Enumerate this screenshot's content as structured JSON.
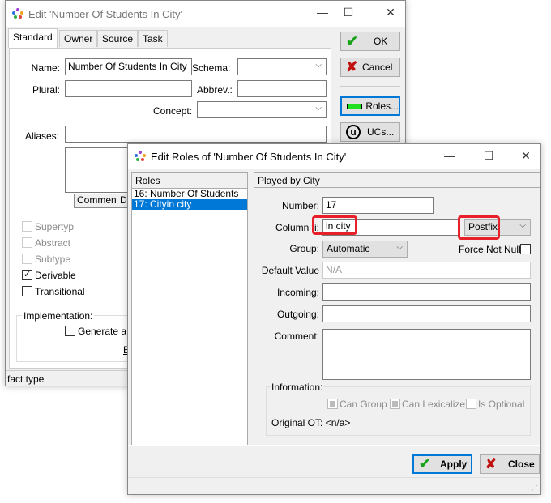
{
  "main_window": {
    "title": "Edit 'Number Of Students In City'",
    "tabs": [
      "Standard",
      "Owner",
      "Source",
      "Task"
    ],
    "fields": {
      "name_label": "Name:",
      "name_value": "Number Of Students In City",
      "schema_label": "Schema:",
      "plural_label": "Plural:",
      "abbrev_label": "Abbrev.:",
      "concept_label": "Concept:",
      "aliases_label": "Aliases:"
    },
    "subtabs": [
      "Comment",
      "De"
    ],
    "checkboxes": [
      {
        "label": "Supertyp",
        "checked": false,
        "disabled": true
      },
      {
        "label": "Abstract",
        "checked": false,
        "disabled": true
      },
      {
        "label": "Subtype",
        "checked": false,
        "disabled": true
      },
      {
        "label": "Derivable",
        "checked": true,
        "disabled": false
      },
      {
        "label": "Transitional",
        "checked": false,
        "disabled": false
      }
    ],
    "implementation_label": "Implementation:",
    "generate_label": "Generate a",
    "partial_link": "E",
    "buttons": {
      "ok": "OK",
      "cancel": "Cancel",
      "roles": "Roles...",
      "ucs": "UCs..."
    },
    "status": "fact type"
  },
  "roles_window": {
    "title": "Edit Roles of 'Number Of Students In City'",
    "roles_header": "Roles",
    "roles": [
      {
        "label": "16: Number Of Students",
        "selected": false
      },
      {
        "label": "17: Cityin city",
        "selected": true
      }
    ],
    "played_by": "Played by City",
    "number_label": "Number:",
    "number_value": "17",
    "column_fix_label": "Column fi",
    "column_fix_value": "in city",
    "fix_type": "Postfix",
    "group_label": "Group:",
    "group_value": "Automatic",
    "force_not_null_label": "Force Not Null",
    "force_not_null": false,
    "default_value_label": "Default Value",
    "default_value_placeholder": "N/A",
    "incoming_label": "Incoming:",
    "outgoing_label": "Outgoing:",
    "comment_label": "Comment:",
    "information_label": "Information:",
    "info_checks": [
      {
        "label": "Can Group",
        "state": "indeterminate"
      },
      {
        "label": "Can Lexicalize",
        "state": "indeterminate"
      },
      {
        "label": "Is Optional",
        "state": "unchecked"
      }
    ],
    "original_ot": "Original OT: <n/a>",
    "buttons": {
      "apply": "Apply",
      "close": "Close"
    }
  },
  "colors": {
    "highlight": "#e8202a",
    "selection": "#0078d7",
    "ok_green": "#1aa31a",
    "cancel_red": "#c01010"
  }
}
